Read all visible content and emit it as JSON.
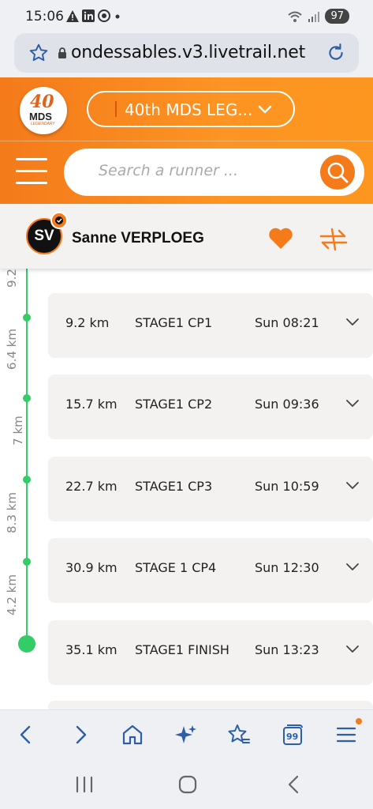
{
  "status_bar": {
    "time": "15:06",
    "icons": [
      "warning-icon",
      "linkedin-icon",
      "chrome-icon",
      "dot-icon"
    ],
    "battery": "97"
  },
  "browser": {
    "url": "ondessables.v3.livetrail.net"
  },
  "header": {
    "logo": {
      "number": "40",
      "brand": "MDS",
      "tagline": "LEGENDARY"
    },
    "event_select_label": "40th MDS LEG...",
    "search_placeholder": "Search a runner ...",
    "accent_color": "#f47a1a"
  },
  "runner": {
    "initials": "SV",
    "name": "Sanne VERPLOEG"
  },
  "timeline": {
    "top_label": "9.2",
    "segments": [
      "6.4 km",
      "7 km",
      "8.3 km",
      "4.2 km"
    ],
    "checkpoints": [
      {
        "distance": "9.2 km",
        "name": "STAGE1 CP1",
        "time": "Sun 08:21"
      },
      {
        "distance": "15.7 km",
        "name": "STAGE1 CP2",
        "time": "Sun 09:36"
      },
      {
        "distance": "22.7 km",
        "name": "STAGE1 CP3",
        "time": "Sun 10:59"
      },
      {
        "distance": "30.9 km",
        "name": "STAGE 1 CP4",
        "time": "Sun 12:30"
      },
      {
        "distance": "35.1 km",
        "name": "STAGE1 FINISH",
        "time": "Sun 13:23"
      }
    ],
    "line_color": "#33cc66"
  },
  "browser_nav": {
    "tab_count": "99",
    "icons": [
      "back-icon",
      "forward-icon",
      "home-icon",
      "sparkle-icon",
      "bookmarks-icon",
      "tabs-icon",
      "menu-icon"
    ]
  }
}
